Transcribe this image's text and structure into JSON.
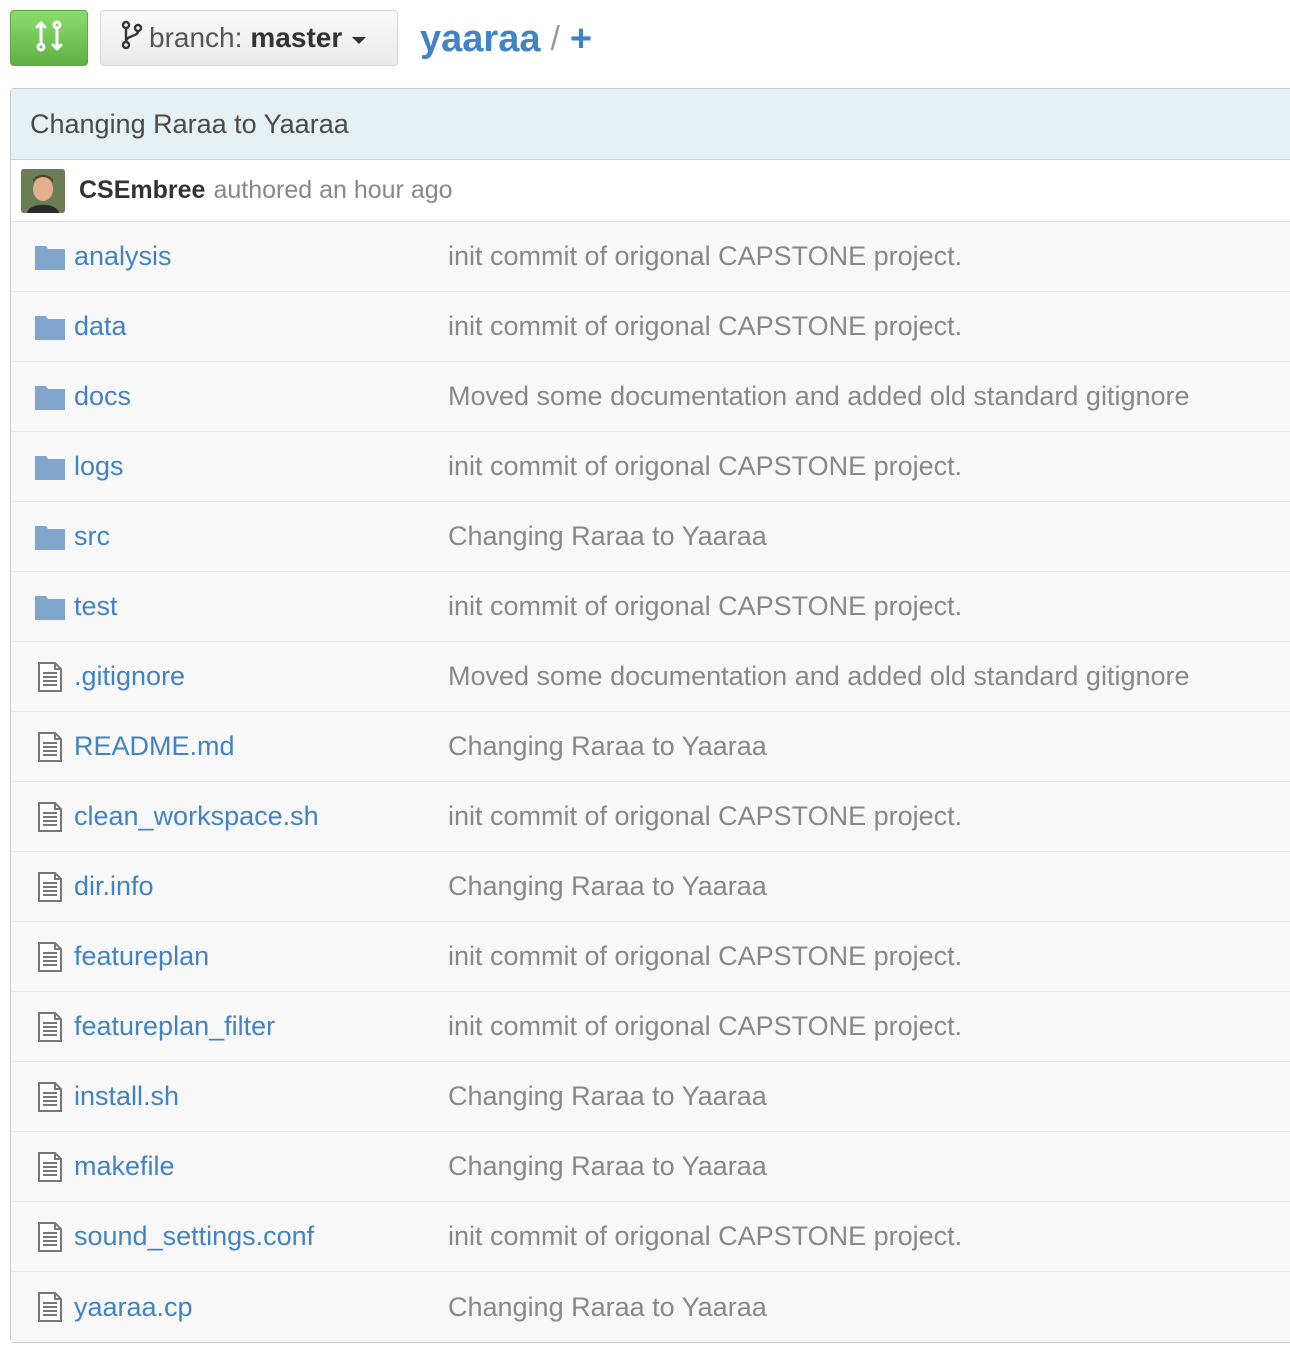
{
  "toolbar": {
    "branch_label": "branch:",
    "branch_value": "master",
    "repo_name": "yaaraa",
    "separator": "/",
    "add_label": "+"
  },
  "commit": {
    "title": "Changing Raraa to Yaaraa",
    "author": "CSEmbree",
    "when": "authored an hour ago"
  },
  "files": [
    {
      "type": "folder",
      "name": "analysis",
      "message": "init commit of origonal CAPSTONE project."
    },
    {
      "type": "folder",
      "name": "data",
      "message": "init commit of origonal CAPSTONE project."
    },
    {
      "type": "folder",
      "name": "docs",
      "message": "Moved some documentation and added old standard gitignore"
    },
    {
      "type": "folder",
      "name": "logs",
      "message": "init commit of origonal CAPSTONE project."
    },
    {
      "type": "folder",
      "name": "src",
      "message": "Changing Raraa to Yaaraa"
    },
    {
      "type": "folder",
      "name": "test",
      "message": "init commit of origonal CAPSTONE project."
    },
    {
      "type": "file",
      "name": ".gitignore",
      "message": "Moved some documentation and added old standard gitignore"
    },
    {
      "type": "file",
      "name": "README.md",
      "message": "Changing Raraa to Yaaraa"
    },
    {
      "type": "file",
      "name": "clean_workspace.sh",
      "message": "init commit of origonal CAPSTONE project."
    },
    {
      "type": "file",
      "name": "dir.info",
      "message": "Changing Raraa to Yaaraa"
    },
    {
      "type": "file",
      "name": "featureplan",
      "message": "init commit of origonal CAPSTONE project."
    },
    {
      "type": "file",
      "name": "featureplan_filter",
      "message": "init commit of origonal CAPSTONE project."
    },
    {
      "type": "file",
      "name": "install.sh",
      "message": "Changing Raraa to Yaaraa"
    },
    {
      "type": "file",
      "name": "makefile",
      "message": "Changing Raraa to Yaaraa"
    },
    {
      "type": "file",
      "name": "sound_settings.conf",
      "message": "init commit of origonal CAPSTONE project."
    },
    {
      "type": "file",
      "name": "yaaraa.cp",
      "message": "Changing Raraa to Yaaraa"
    }
  ]
}
